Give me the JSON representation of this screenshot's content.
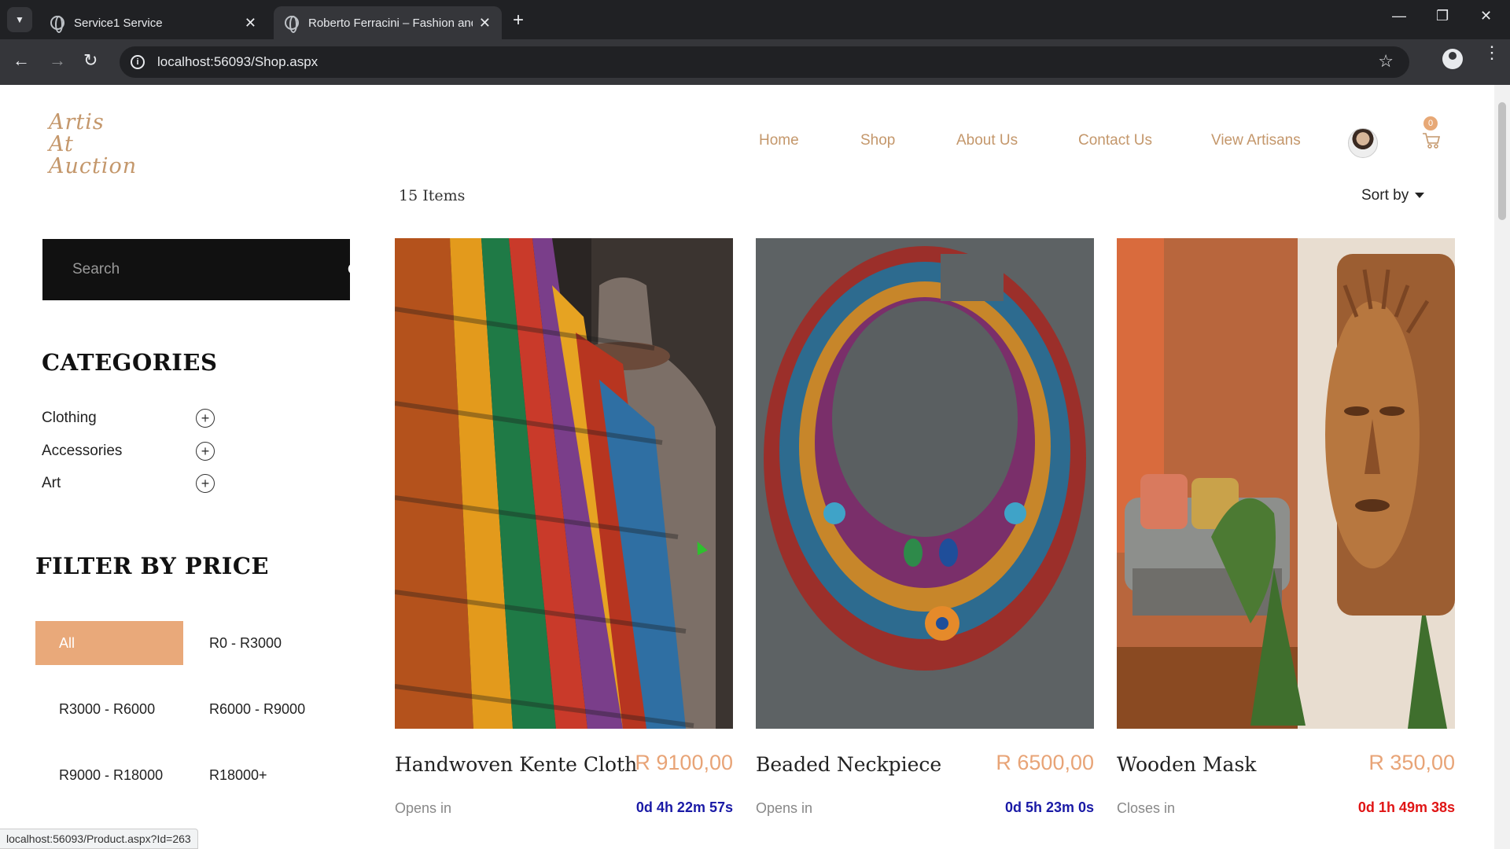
{
  "browser": {
    "tabs": [
      {
        "title": "Service1 Service"
      },
      {
        "title": "Roberto Ferracini – Fashion and"
      }
    ],
    "url": "localhost:56093/Shop.aspx",
    "status_url": "localhost:56093/Product.aspx?Id=263"
  },
  "site": {
    "logo_lines": [
      "Artis",
      "At",
      "Auction"
    ],
    "nav": [
      "Home",
      "Shop",
      "About Us",
      "Contact Us",
      "View Artisans"
    ],
    "cart_count": "0",
    "accent": "#c4976b"
  },
  "shop": {
    "item_count": "15 Items",
    "sort_label": "Sort by"
  },
  "sidebar": {
    "search_placeholder": "Search",
    "categories_title": "CATEGORIES",
    "categories": [
      "Clothing",
      "Accessories",
      "Art"
    ],
    "price_title": "FILTER BY PRICE",
    "price_filters": [
      "All",
      "R0 - R3000",
      "R3000 - R6000",
      "R6000 - R9000",
      "R9000 - R18000",
      "R18000+"
    ],
    "active_price_filter": "All"
  },
  "products": [
    {
      "name": "Handwoven Kente Cloth",
      "price": "R 9100,00",
      "status": "Opens in",
      "timer": "0d 4h 22m 57s",
      "timer_color": "blue"
    },
    {
      "name": "Beaded Neckpiece",
      "price": "R 6500,00",
      "status": "Opens in",
      "timer": "0d 5h 23m 0s",
      "timer_color": "blue"
    },
    {
      "name": "Wooden Mask",
      "price": "R 350,00",
      "status": "Closes in",
      "timer": "0d 1h 49m 38s",
      "timer_color": "red"
    }
  ]
}
